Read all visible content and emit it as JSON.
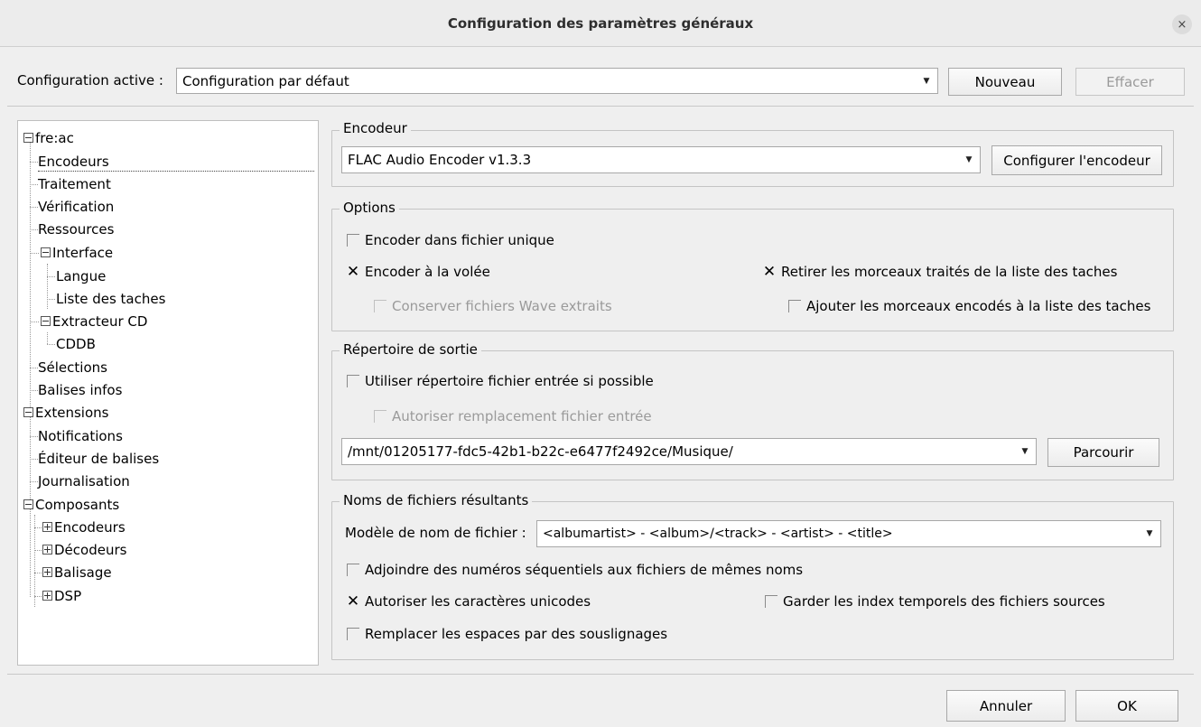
{
  "window": {
    "title": "Configuration des paramètres généraux",
    "close_glyph": "×"
  },
  "config": {
    "label": "Configuration active :",
    "value": "Configuration par défaut",
    "new_label": "Nouveau",
    "delete_label": "Effacer"
  },
  "tree": {
    "items": [
      {
        "label": "fre:ac"
      },
      {
        "label": "Encodeurs"
      },
      {
        "label": "Traitement"
      },
      {
        "label": "Vérification"
      },
      {
        "label": "Ressources"
      },
      {
        "label": "Interface"
      },
      {
        "label": "Langue"
      },
      {
        "label": "Liste des taches"
      },
      {
        "label": "Extracteur CD"
      },
      {
        "label": "CDDB"
      },
      {
        "label": "Sélections"
      },
      {
        "label": "Balises infos"
      },
      {
        "label": "Extensions"
      },
      {
        "label": "Notifications"
      },
      {
        "label": "Éditeur de balises"
      },
      {
        "label": "Journalisation"
      },
      {
        "label": "Composants"
      },
      {
        "label": "Encodeurs"
      },
      {
        "label": "Décodeurs"
      },
      {
        "label": "Balisage"
      },
      {
        "label": "DSP"
      }
    ]
  },
  "encoder": {
    "group_title": "Encodeur",
    "value": "FLAC Audio Encoder v1.3.3",
    "configure_label": "Configurer l'encodeur"
  },
  "options": {
    "group_title": "Options",
    "single_file": "Encoder dans fichier unique",
    "on_the_fly": "Encoder à la volée",
    "keep_wave": "Conserver fichiers Wave extraits",
    "remove_processed": "Retirer les morceaux traités de la liste des taches",
    "add_encoded": "Ajouter les morceaux encodés à la liste des taches",
    "check_mark": "✕"
  },
  "output": {
    "group_title": "Répertoire de sortie",
    "use_input_dir": "Utiliser répertoire fichier entrée si possible",
    "allow_overwrite": "Autoriser remplacement fichier entrée",
    "path": "/mnt/01205177-fdc5-42b1-b22c-e6477f2492ce/Musique/",
    "browse_label": "Parcourir"
  },
  "filenames": {
    "group_title": "Noms de fichiers résultants",
    "pattern_label": "Modèle de nom de fichier :",
    "pattern_value": "<albumartist> - <album>/<track> - <artist> - <title>",
    "sequential": "Adjoindre des numéros séquentiels aux fichiers de mêmes noms",
    "unicode": "Autoriser les caractères unicodes",
    "keep_index": "Garder les index temporels des fichiers sources",
    "replace_spaces": "Remplacer les espaces par des souslignages"
  },
  "footer": {
    "cancel_label": "Annuler",
    "ok_label": "OK"
  },
  "icons": {
    "dropdown": "▼"
  }
}
